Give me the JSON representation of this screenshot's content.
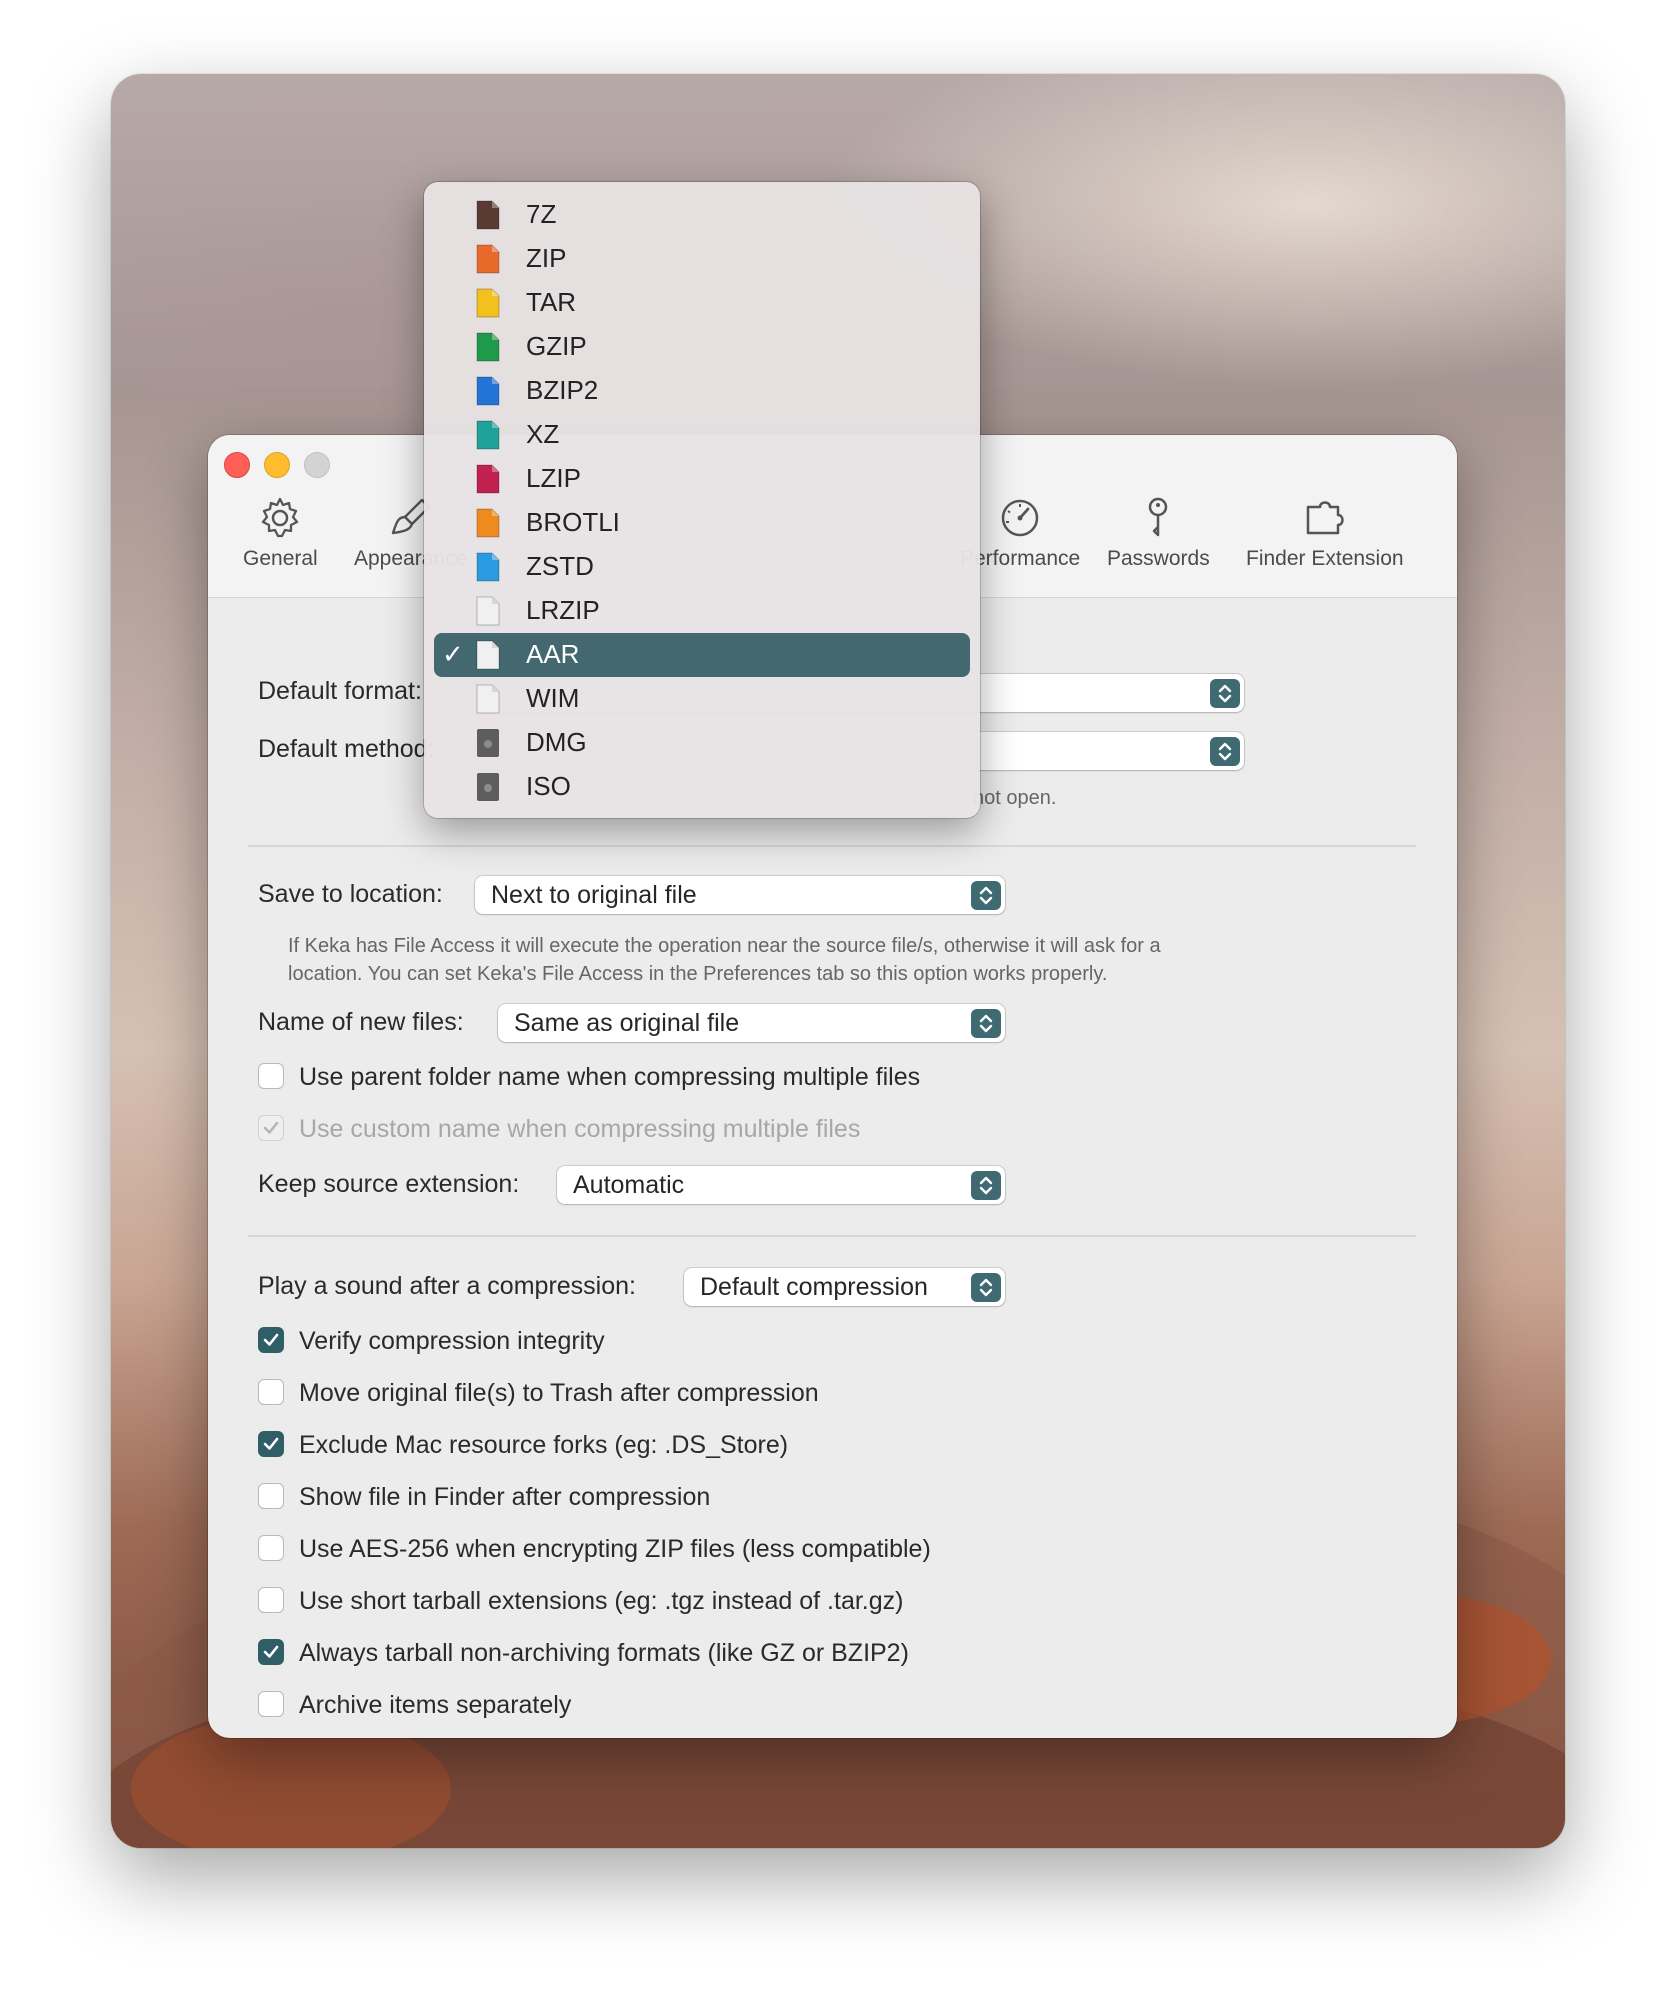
{
  "window": {
    "toolbar": {
      "items": [
        {
          "label": "General",
          "icon": "gear-icon"
        },
        {
          "label": "Appearance",
          "icon": "brush-icon"
        },
        {
          "label": "Performance",
          "icon": "speedometer-icon"
        },
        {
          "label": "Passwords",
          "icon": "key-icon"
        },
        {
          "label": "Finder Extension",
          "icon": "puzzle-icon"
        }
      ]
    },
    "format": {
      "label": "Default format:",
      "menu": [
        {
          "label": "7Z",
          "color": "#5a3b34"
        },
        {
          "label": "ZIP",
          "color": "#e9692a"
        },
        {
          "label": "TAR",
          "color": "#f3c11d"
        },
        {
          "label": "GZIP",
          "color": "#1f9a4b"
        },
        {
          "label": "BZIP2",
          "color": "#2474d8"
        },
        {
          "label": "XZ",
          "color": "#1ea29a"
        },
        {
          "label": "LZIP",
          "color": "#c2204f"
        },
        {
          "label": "BROTLI",
          "color": "#ef8a1e"
        },
        {
          "label": "ZSTD",
          "color": "#2a9be3"
        },
        {
          "label": "LRZIP",
          "color": "#f0f0f0"
        },
        {
          "label": "AAR",
          "color": "#f0f0f0",
          "selected": true
        },
        {
          "label": "WIM",
          "color": "#f0f0f0"
        },
        {
          "label": "DMG",
          "color": "#5d5d5d"
        },
        {
          "label": "ISO",
          "color": "#5d5d5d"
        }
      ]
    },
    "method": {
      "label": "Default method:",
      "note_tail": "not open."
    },
    "save": {
      "label": "Save to location:",
      "value": "Next to original file",
      "note_line1": "If Keka has File Access it will execute the operation near the source file/s, otherwise it will ask for a",
      "note_line2": "location. You can set Keka's File Access in the Preferences tab so this option works properly."
    },
    "naming": {
      "label": "Name of new files:",
      "value": "Same as original file"
    },
    "parent_folder": {
      "label": "Use parent folder name when compressing multiple files",
      "checked": false
    },
    "custom_name": {
      "label": "Use custom name when compressing multiple files",
      "checked": true,
      "disabled": true
    },
    "keep_ext": {
      "label": "Keep source extension:",
      "value": "Automatic"
    },
    "sound": {
      "label": "Play a sound after a compression:",
      "value": "Default compression"
    },
    "options": [
      {
        "label": "Verify compression integrity",
        "checked": true
      },
      {
        "label": "Move original file(s) to Trash after compression",
        "checked": false
      },
      {
        "label": "Exclude Mac resource forks (eg: .DS_Store)",
        "checked": true
      },
      {
        "label": "Show file in Finder after compression",
        "checked": false
      },
      {
        "label": "Use AES-256 when encrypting ZIP files (less compatible)",
        "checked": false
      },
      {
        "label": "Use short tarball extensions (eg: .tgz instead of .tar.gz)",
        "checked": false
      },
      {
        "label": "Always tarball non-archiving formats (like GZ or BZIP2)",
        "checked": true
      },
      {
        "label": "Archive items separately",
        "checked": false
      }
    ],
    "accent": "#3f6a71"
  }
}
